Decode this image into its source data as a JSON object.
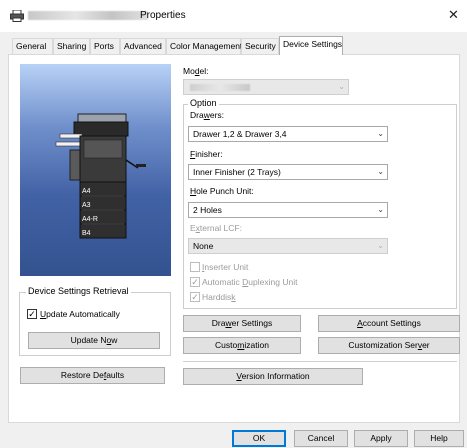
{
  "window": {
    "title": "Properties",
    "close": "✕"
  },
  "tabs": [
    {
      "label": "General"
    },
    {
      "label": "Sharing"
    },
    {
      "label": "Ports"
    },
    {
      "label": "Advanced"
    },
    {
      "label": "Color Management"
    },
    {
      "label": "Security"
    },
    {
      "label": "Device Settings",
      "active": true
    }
  ],
  "preview": {
    "paper_labels": [
      "A4",
      "A3",
      "A4-R",
      "B4"
    ]
  },
  "retrieval": {
    "title": "Device Settings Retrieval",
    "update_auto_pre": "",
    "update_auto_ul": "U",
    "update_auto_post": "pdate Automatically",
    "update_auto_checked": true,
    "update_now_pre": "Update N",
    "update_now_ul": "o",
    "update_now_post": "w"
  },
  "restore_defaults": {
    "pre": "Restore De",
    "ul": "f",
    "post": "aults"
  },
  "model": {
    "label_pre": "Mo",
    "label_ul": "d",
    "label_post": "el:",
    "arrow": "⌄"
  },
  "option": {
    "title": "Option",
    "drawers": {
      "label_pre": "Dra",
      "label_ul": "w",
      "label_post": "ers:",
      "value": "Drawer 1,2 & Drawer 3,4"
    },
    "finisher": {
      "label_pre": "",
      "label_ul": "F",
      "label_post": "inisher:",
      "value": "Inner Finisher (2 Trays)"
    },
    "hole_punch": {
      "label_pre": "",
      "label_ul": "H",
      "label_post": "ole Punch Unit:",
      "value": "2 Holes"
    },
    "external_lcf": {
      "label_pre": "E",
      "label_ul": "x",
      "label_post": "ternal LCF:",
      "value": "None"
    },
    "inserter": {
      "pre": "",
      "ul": "I",
      "post": "nserter Unit",
      "checked": false
    },
    "auto_duplex": {
      "pre": "Automatic ",
      "ul": "D",
      "post": "uplexing Unit",
      "checked": true
    },
    "harddisk": {
      "pre": "Harddis",
      "ul": "k",
      "post": "",
      "checked": true
    }
  },
  "buttons": {
    "drawer_settings": {
      "pre": "Dra",
      "ul": "w",
      "post": "er Settings"
    },
    "account_settings": {
      "pre": "",
      "ul": "A",
      "post": "ccount Settings"
    },
    "customization": {
      "pre": "Custo",
      "ul": "m",
      "post": "ization"
    },
    "customization_server": {
      "pre": "Customization Ser",
      "ul": "v",
      "post": "er"
    },
    "version_information": {
      "pre": "",
      "ul": "V",
      "post": "ersion Information"
    }
  },
  "footer": {
    "ok": "OK",
    "cancel": "Cancel",
    "apply": "Apply",
    "help": "Help"
  },
  "colors": {
    "accent": "#0078d7",
    "preview_top": "#b8d1f6",
    "preview_bottom": "#33528f"
  }
}
